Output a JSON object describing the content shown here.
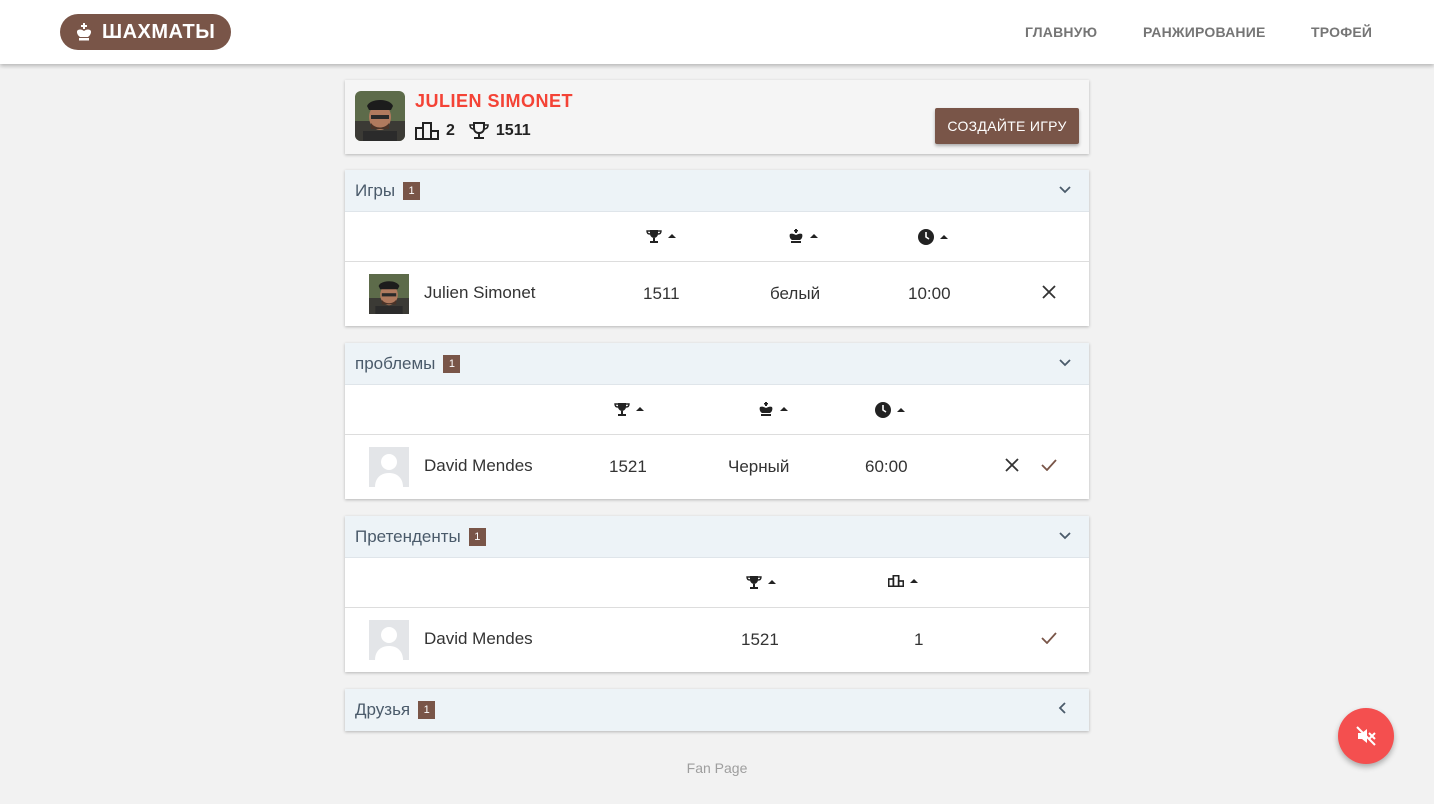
{
  "app": {
    "logo_text": "ШАХМАТЫ",
    "logo_icon": "chess-king-icon"
  },
  "nav": {
    "items": [
      {
        "label": "ГЛАВНУЮ"
      },
      {
        "label": "РАНЖИРОВАНИЕ"
      },
      {
        "label": "ТРОФЕЙ"
      }
    ]
  },
  "profile": {
    "name": "JULIEN SIMONET",
    "rank_value": "2",
    "trophy_value": "1511",
    "create_button": "СОЗДАЙТЕ ИГРУ"
  },
  "sections": {
    "games": {
      "title": "Игры",
      "count": "1",
      "rows": [
        {
          "name": "Julien Simonet",
          "rating": "1511",
          "color": "белый",
          "time": "10:00"
        }
      ]
    },
    "problems": {
      "title": "проблемы",
      "count": "1",
      "rows": [
        {
          "name": "David Mendes",
          "rating": "1521",
          "color": "Черный",
          "time": "60:00"
        }
      ]
    },
    "contenders": {
      "title": "Претенденты",
      "count": "1",
      "rows": [
        {
          "name": "David Mendes",
          "rating": "1521",
          "rank": "1"
        }
      ]
    },
    "friends": {
      "title": "Друзья",
      "count": "1",
      "expanded": false
    }
  },
  "footer": {
    "text": "Fan Page"
  },
  "colors": {
    "brand": "#795548",
    "accent_red": "#f44336",
    "fab": "#f44f4f"
  }
}
